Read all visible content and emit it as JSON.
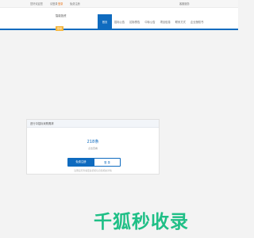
{
  "topbar": {
    "welcome": "您好欢迎您",
    "login_prefix": "请登录",
    "login_link": "登录",
    "register": "免费注册",
    "right_link": "客服服务"
  },
  "header": {
    "site_name": "智能投资",
    "badge": "登录"
  },
  "nav": {
    "items": [
      {
        "label": "首页",
        "active": true
      },
      {
        "label": "招标公告",
        "active": false
      },
      {
        "label": "招标预告",
        "active": false
      },
      {
        "label": "中标公告",
        "active": false
      },
      {
        "label": "项目信息",
        "active": false
      },
      {
        "label": "联系方式",
        "active": false
      },
      {
        "label": "企业授权书",
        "active": false
      }
    ]
  },
  "card": {
    "title": "进行中招标采购需求",
    "count": "218条",
    "sub": "点击查看",
    "primary_button": "免费注册",
    "secondary_button": "登 录",
    "hint": "注册后可查看更多招标信息和相关详情"
  },
  "watermark": {
    "text": "千狐秒收录"
  },
  "colors": {
    "brand": "#0f6bbf",
    "accent": "#e8741a",
    "badge": "#f4b63f",
    "watermark": "#1fbf86"
  }
}
